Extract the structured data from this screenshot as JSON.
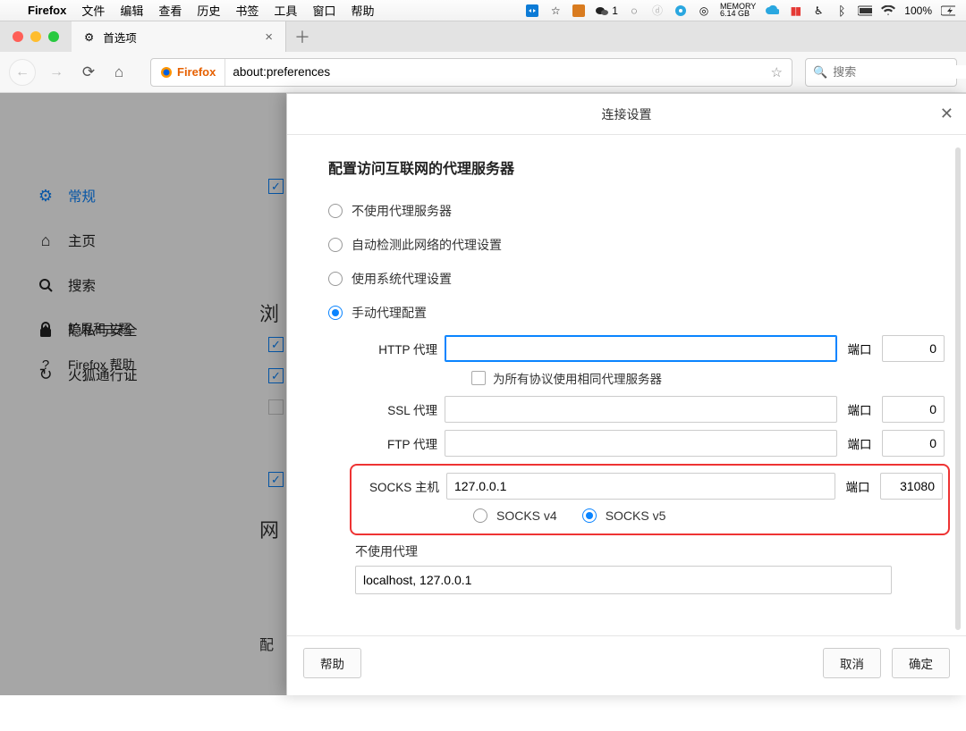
{
  "menubar": {
    "app": "Firefox",
    "items": [
      "文件",
      "编辑",
      "查看",
      "历史",
      "书签",
      "工具",
      "窗口",
      "帮助"
    ],
    "wechat_badge": "1",
    "memory_label": "MEMORY",
    "memory_value": "6.14 GB",
    "battery": "100%"
  },
  "tab": {
    "title": "首选项"
  },
  "toolbar": {
    "identity": "Firefox",
    "url": "about:preferences",
    "search_placeholder": "搜索"
  },
  "sidebar": {
    "items": [
      {
        "icon": "gear",
        "label": "常规",
        "active": true
      },
      {
        "icon": "home",
        "label": "主页"
      },
      {
        "icon": "search",
        "label": "搜索"
      },
      {
        "icon": "lock",
        "label": "隐私与安全"
      },
      {
        "icon": "sync",
        "label": "火狐通行证"
      }
    ],
    "bottom": [
      {
        "icon": "puzzle",
        "label": "扩展和主题"
      },
      {
        "icon": "help",
        "label": "Firefox 帮助"
      }
    ]
  },
  "bg": {
    "section1": "浏",
    "section2": "网",
    "section3": "配"
  },
  "dialog": {
    "title": "连接设置",
    "heading": "配置访问互联网的代理服务器",
    "opts": {
      "no_proxy": "不使用代理服务器",
      "auto_detect": "自动检测此网络的代理设置",
      "system": "使用系统代理设置",
      "manual": "手动代理配置"
    },
    "labels": {
      "http": "HTTP 代理",
      "ssl": "SSL 代理",
      "ftp": "FTP 代理",
      "socks": "SOCKS 主机",
      "port": "端口",
      "share": "为所有协议使用相同代理服务器",
      "socks4": "SOCKS v4",
      "socks5": "SOCKS v5",
      "noproxy_heading": "不使用代理"
    },
    "values": {
      "http_host": "",
      "http_port": "0",
      "ssl_host": "",
      "ssl_port": "0",
      "ftp_host": "",
      "ftp_port": "0",
      "socks_host": "127.0.0.1",
      "socks_port": "31080",
      "noproxy_list": "localhost, 127.0.0.1"
    },
    "buttons": {
      "help": "帮助",
      "cancel": "取消",
      "ok": "确定"
    }
  }
}
